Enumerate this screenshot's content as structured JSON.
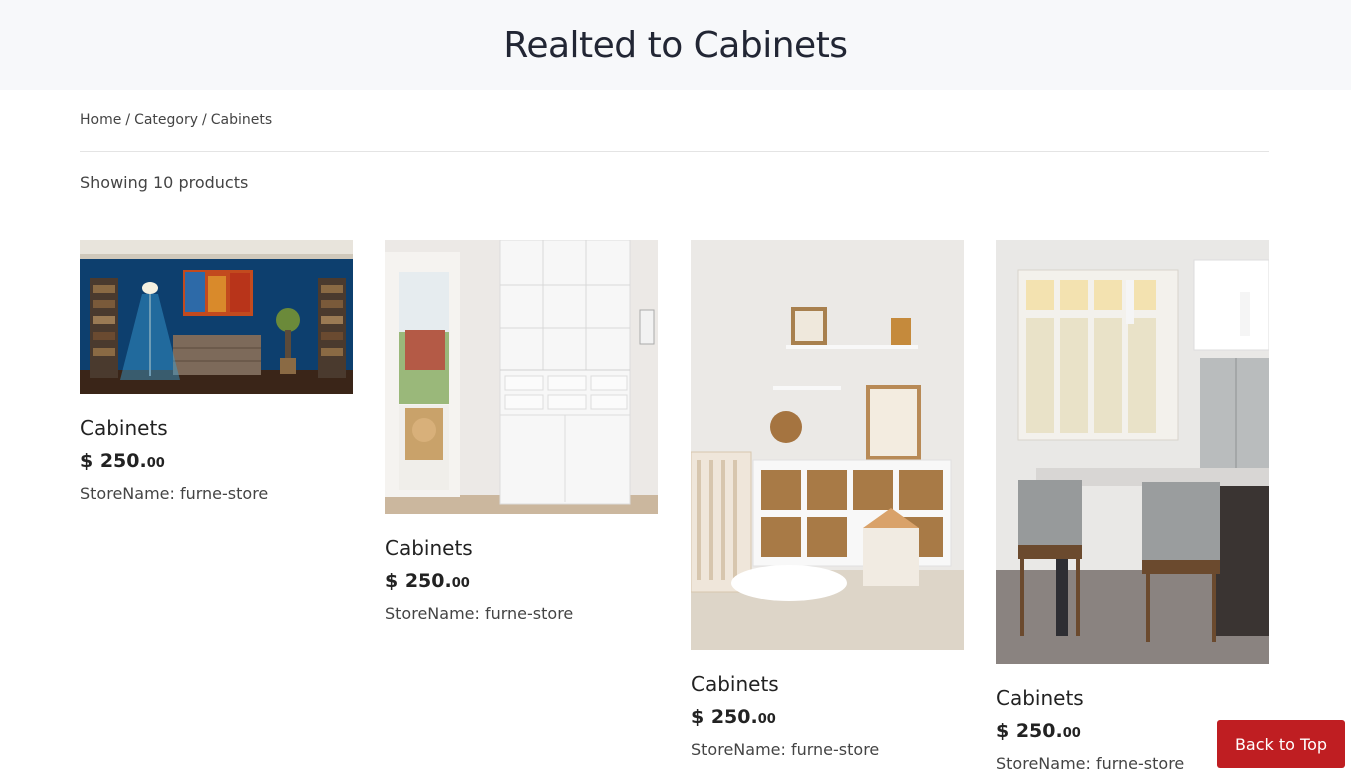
{
  "header": {
    "title": "Realted to Cabinets"
  },
  "breadcrumb": {
    "home": "Home",
    "category": "Category",
    "current": "Cabinets",
    "separator": "/"
  },
  "listing": {
    "showing": "Showing 10 products"
  },
  "products": [
    {
      "name": "Cabinets",
      "price_main": "$ 250.",
      "price_cents": "00",
      "store": "StoreName: furne-store",
      "image": "living-room-blue-wall"
    },
    {
      "name": "Cabinets",
      "price_main": "$ 250.",
      "price_cents": "00",
      "store": "StoreName: furne-store",
      "image": "white-bookcase-dog"
    },
    {
      "name": "Cabinets",
      "price_main": "$ 250.",
      "price_cents": "00",
      "store": "StoreName: furne-store",
      "image": "nursery-cube-shelf"
    },
    {
      "name": "Cabinets",
      "price_main": "$ 250.",
      "price_cents": "00",
      "store": "StoreName: furne-store",
      "image": "kitchen-island"
    }
  ],
  "back_to_top": "Back to Top",
  "colors": {
    "accent": "#bf1e22",
    "header_bg": "#f7f8fa"
  }
}
